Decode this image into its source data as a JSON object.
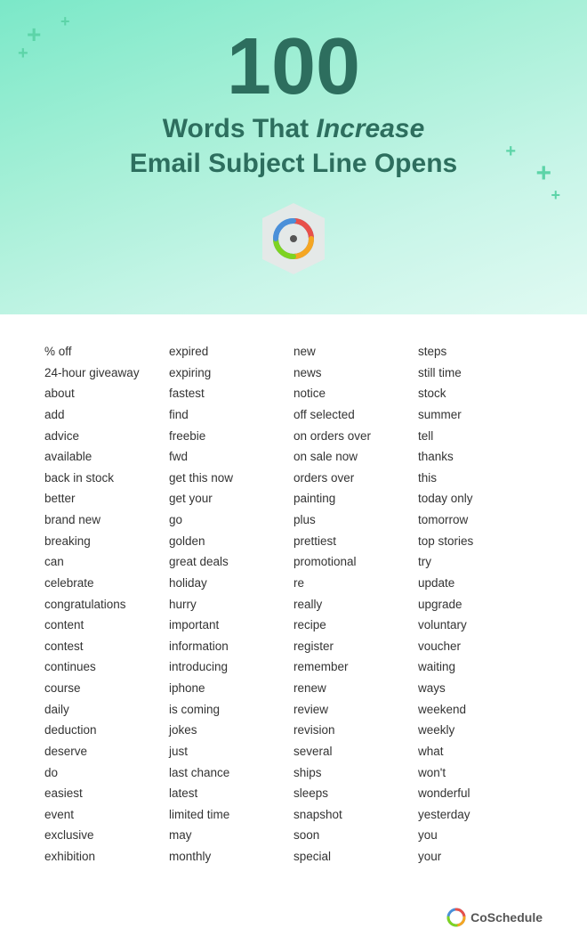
{
  "header": {
    "number": "100",
    "line1_prefix": "Words That ",
    "line1_italic": "Increase",
    "line2": "Email Subject Line Opens"
  },
  "columns": {
    "col1": [
      "% off",
      "24-hour giveaway",
      "about",
      "add",
      "advice",
      "available",
      "back in stock",
      "better",
      "brand new",
      "breaking",
      "can",
      "celebrate",
      "congratulations",
      "content",
      "contest",
      "continues",
      "course",
      "daily",
      "deduction",
      "deserve",
      "do",
      "easiest",
      "event",
      "exclusive",
      "exhibition"
    ],
    "col2": [
      "expired",
      "expiring",
      "fastest",
      "find",
      "freebie",
      "fwd",
      "get this now",
      "get your",
      "go",
      "golden",
      "great deals",
      "holiday",
      "hurry",
      "important",
      "information",
      "introducing",
      "iphone",
      "is coming",
      "jokes",
      "just",
      "last chance",
      "latest",
      "limited time",
      "may",
      "monthly"
    ],
    "col3": [
      "new",
      "news",
      "notice",
      "off selected",
      "on orders over",
      "on sale now",
      "orders over",
      "painting",
      "plus",
      "prettiest",
      "promotional",
      "re",
      "really",
      "recipe",
      "register",
      "remember",
      "renew",
      "review",
      "revision",
      "several",
      "ships",
      "sleeps",
      "snapshot",
      "soon",
      "special"
    ],
    "col4": [
      "steps",
      "still time",
      "stock",
      "summer",
      "tell",
      "thanks",
      "this",
      "today only",
      "tomorrow",
      "top stories",
      "try",
      "update",
      "upgrade",
      "voluntary",
      "voucher",
      "waiting",
      "ways",
      "weekend",
      "weekly",
      "what",
      "won't",
      "wonderful",
      "yesterday",
      "you",
      "your"
    ]
  },
  "footer": {
    "brand": "CoSchedule"
  }
}
